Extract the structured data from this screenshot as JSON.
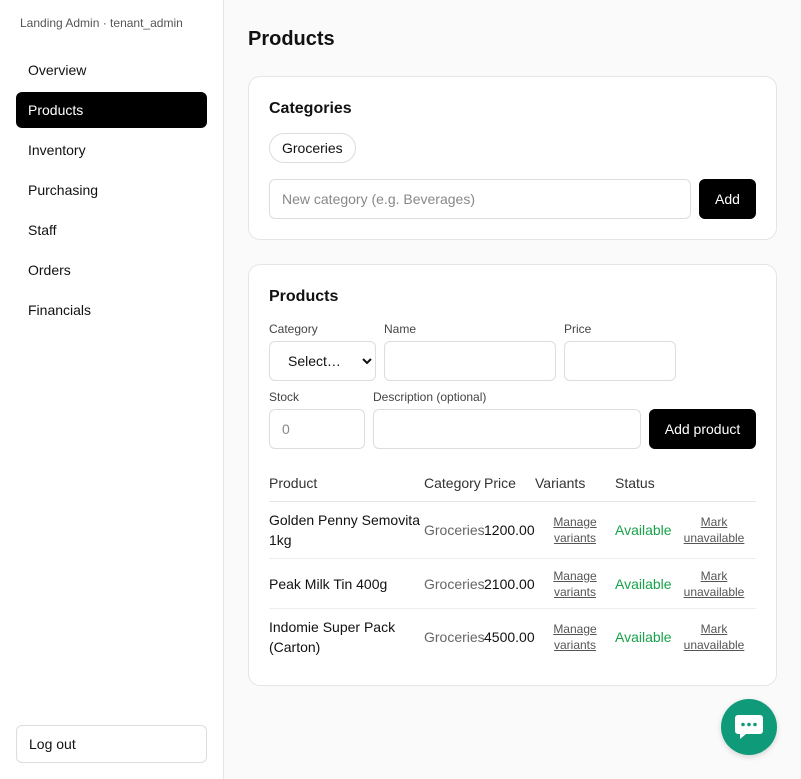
{
  "sidebar": {
    "brand": "Landing Admin · tenant_admin",
    "items": [
      {
        "label": "Overview",
        "active": false
      },
      {
        "label": "Products",
        "active": true
      },
      {
        "label": "Inventory",
        "active": false
      },
      {
        "label": "Purchasing",
        "active": false
      },
      {
        "label": "Staff",
        "active": false
      },
      {
        "label": "Orders",
        "active": false
      },
      {
        "label": "Financials",
        "active": false
      }
    ],
    "logout_label": "Log out"
  },
  "page": {
    "title": "Products"
  },
  "categories": {
    "title": "Categories",
    "chips": [
      "Groceries"
    ],
    "input_placeholder": "New category (e.g. Beverages)",
    "add_label": "Add"
  },
  "products": {
    "title": "Products",
    "form": {
      "category_label": "Category",
      "category_selected": "Select…",
      "name_label": "Name",
      "name_value": "",
      "price_label": "Price",
      "price_value": "",
      "stock_label": "Stock",
      "stock_placeholder": "0",
      "description_label": "Description (optional)",
      "description_value": "",
      "add_label": "Add product"
    },
    "table": {
      "headers": {
        "product": "Product",
        "category": "Category",
        "price": "Price",
        "variants": "Variants",
        "status": "Status"
      },
      "rows": [
        {
          "product": "Golden Penny Semovita 1kg",
          "category": "Groceries",
          "price": "1200.00",
          "variants_action": "Manage variants",
          "status": "Available",
          "toggle_action": "Mark unavailable"
        },
        {
          "product": "Peak Milk Tin 400g",
          "category": "Groceries",
          "price": "2100.00",
          "variants_action": "Manage variants",
          "status": "Available",
          "toggle_action": "Mark unavailable"
        },
        {
          "product": "Indomie Super Pack (Carton)",
          "category": "Groceries",
          "price": "4500.00",
          "variants_action": "Manage variants",
          "status": "Available",
          "toggle_action": "Mark unavailable"
        }
      ]
    }
  },
  "chat": {
    "icon": "chat-bubble-icon",
    "color": "#0f9b7a"
  },
  "colors": {
    "accent": "#000000",
    "status_available": "#16a34a"
  }
}
